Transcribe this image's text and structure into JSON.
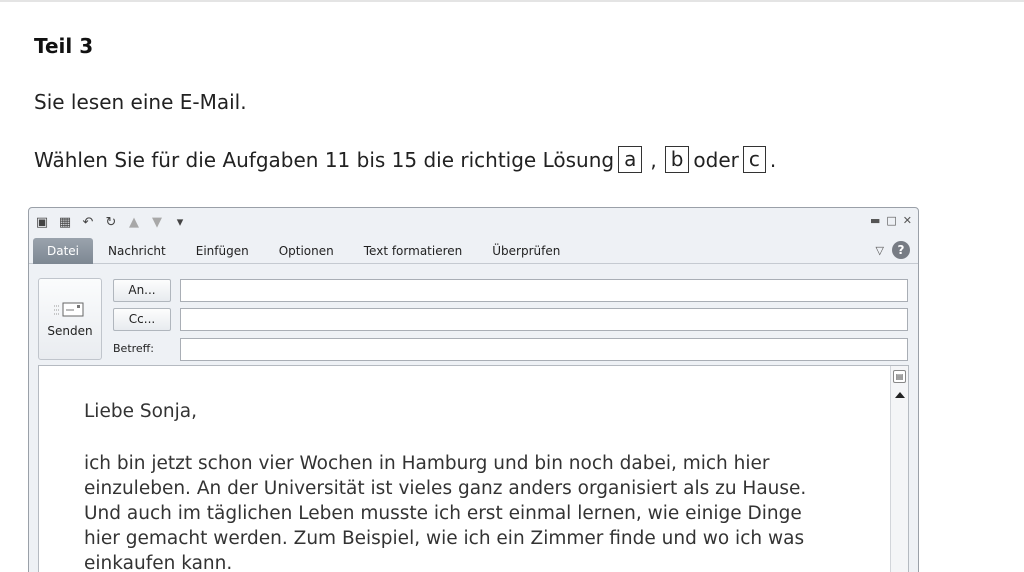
{
  "heading": "Teil 3",
  "intro": "Sie lesen eine E-Mail.",
  "instruction": {
    "text": "Wählen Sie für die Aufgaben 11 bis 15 die richtige Lösung",
    "options": [
      "a",
      "b",
      "c"
    ],
    "separator": ",",
    "connector": "oder",
    "end": "."
  },
  "window": {
    "tabs": [
      "Datei",
      "Nachricht",
      "Einfügen",
      "Optionen",
      "Text formatieren",
      "Überprüfen"
    ],
    "send_label": "Senden",
    "to_label": "An...",
    "cc_label": "Cc...",
    "subject_label": "Betreff:",
    "to_value": "",
    "cc_value": "",
    "subject_value": ""
  },
  "email": {
    "greeting": "Liebe Sonja,",
    "lines": [
      "ich bin jetzt schon vier Wochen in Hamburg und bin noch dabei, mich hier",
      "einzuleben. An der Universität ist vieles ganz anders organisiert als zu Hause.",
      "Und auch im täglichen Leben musste ich erst einmal lernen, wie einige Dinge",
      "hier gemacht werden. Zum Beispiel, wie ich ein Zimmer finde und wo ich was",
      "einkaufen kann."
    ]
  },
  "icons": [
    "account-icon",
    "save-icon",
    "undo-icon",
    "redo-icon",
    "up-arrow-icon",
    "down-arrow-icon",
    "customize-icon",
    "minimize-icon",
    "restore-icon",
    "close-icon",
    "help-icon",
    "send-icon",
    "ribbon-collapse-icon",
    "scroll-up-icon",
    "split-view-icon"
  ]
}
